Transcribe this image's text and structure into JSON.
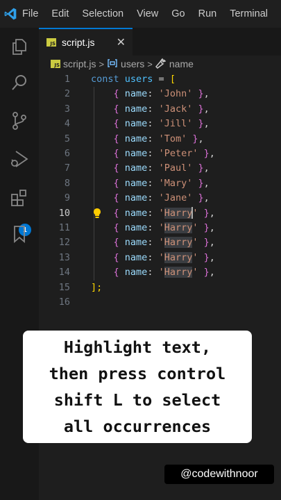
{
  "menubar": {
    "items": [
      "File",
      "Edit",
      "Selection",
      "View",
      "Go",
      "Run",
      "Terminal"
    ]
  },
  "activitybar": {
    "icons": [
      "explorer-icon",
      "search-icon",
      "source-control-icon",
      "run-debug-icon",
      "extensions-icon",
      "bookmarks-icon"
    ],
    "extensions_badge": "1"
  },
  "tab": {
    "icon_text": "JS",
    "label": "script.js",
    "close": "✕"
  },
  "breadcrumb": {
    "file": "script.js",
    "symbol1": "users",
    "symbol2": "name",
    "sep": ">"
  },
  "editor": {
    "line_numbers": [
      "1",
      "2",
      "3",
      "4",
      "5",
      "6",
      "7",
      "8",
      "9",
      "10",
      "11",
      "12",
      "13",
      "14",
      "15",
      "16"
    ],
    "active_line": "10",
    "declaration": {
      "keyword": "const",
      "name": "users",
      "op": " = ",
      "open": "["
    },
    "objects": [
      {
        "key": "name",
        "value": "John"
      },
      {
        "key": "name",
        "value": "Jack"
      },
      {
        "key": "name",
        "value": "Jill"
      },
      {
        "key": "name",
        "value": "Tom"
      },
      {
        "key": "name",
        "value": "Peter"
      },
      {
        "key": "name",
        "value": "Paul"
      },
      {
        "key": "name",
        "value": "Mary"
      },
      {
        "key": "name",
        "value": "Jane"
      },
      {
        "key": "name",
        "value": "Harry"
      },
      {
        "key": "name",
        "value": "Harry"
      },
      {
        "key": "name",
        "value": "Harry"
      },
      {
        "key": "name",
        "value": "Harry"
      },
      {
        "key": "name",
        "value": "Harry"
      }
    ],
    "closing": "];"
  },
  "caption": {
    "lines": [
      "Highlight text,",
      "then press control",
      "shift L to select",
      "all occurrences"
    ]
  },
  "watermark": "@codewithnoor",
  "colors": {
    "accent": "#0078d4",
    "keyword": "#569cd6",
    "string": "#ce9178",
    "property": "#9cdcfe"
  }
}
